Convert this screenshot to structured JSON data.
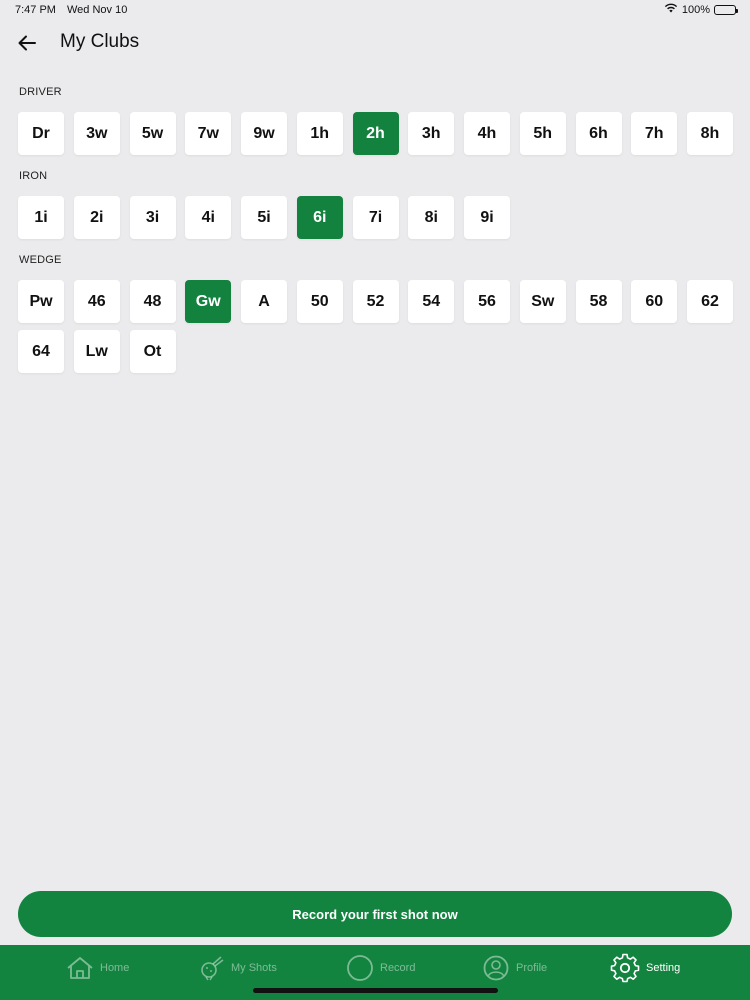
{
  "status": {
    "time": "7:47 PM",
    "date": "Wed Nov 10",
    "battery": "100%"
  },
  "header": {
    "title": "My Clubs"
  },
  "sections": [
    {
      "label": "DRIVER",
      "clubs": [
        "Dr",
        "3w",
        "5w",
        "7w",
        "9w",
        "1h",
        "2h",
        "3h",
        "4h",
        "5h",
        "6h",
        "7h",
        "8h"
      ],
      "selected": "2h"
    },
    {
      "label": "IRON",
      "clubs": [
        "1i",
        "2i",
        "3i",
        "4i",
        "5i",
        "6i",
        "7i",
        "8i",
        "9i"
      ],
      "selected": "6i"
    },
    {
      "label": "WEDGE",
      "clubs": [
        "Pw",
        "46",
        "48",
        "Gw",
        "A",
        "50",
        "52",
        "54",
        "56",
        "Sw",
        "58",
        "60",
        "62",
        "64",
        "Lw",
        "Ot"
      ],
      "selected": "Gw"
    }
  ],
  "cta": {
    "label": "Record your first shot now"
  },
  "tabs": [
    {
      "label": "Home",
      "icon": "home-icon",
      "active": false
    },
    {
      "label": "My Shots",
      "icon": "golf-shots-icon",
      "active": false
    },
    {
      "label": "Record",
      "icon": "record-icon",
      "active": false
    },
    {
      "label": "Profile",
      "icon": "profile-icon",
      "active": false
    },
    {
      "label": "Setting",
      "icon": "gear-icon",
      "active": true
    }
  ],
  "colors": {
    "accent": "#12843f",
    "background": "#ebebed",
    "chip": "#ffffff"
  }
}
